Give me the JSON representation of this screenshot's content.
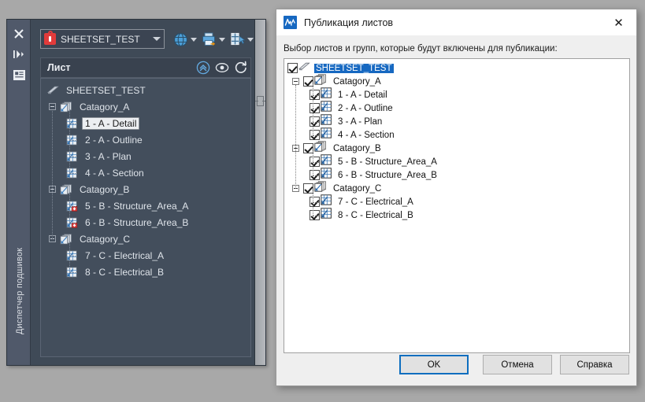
{
  "colors": {
    "desktop": "#a8a8a8",
    "palette_bg": "#3f4a57",
    "palette_gutter": "#50596a",
    "accent_blue": "#1668c1",
    "lock_red": "#e23b3b",
    "dialog_bg": "#efefef",
    "tree_bg": "#ffffff"
  },
  "palette": {
    "gutter": {
      "label": "Диспетчер подшивок",
      "icons": [
        {
          "name": "close-icon",
          "glyph": "✕"
        },
        {
          "name": "auto-hide-icon",
          "glyph": "⏯"
        },
        {
          "name": "properties-icon",
          "glyph": "▤"
        }
      ]
    },
    "combo": {
      "value": "SHEETSET_TEST",
      "icon": "lock-icon"
    },
    "toolbar": [
      {
        "name": "publish-button",
        "icon": "publish-globe-icon",
        "has_dropdown": true
      },
      {
        "name": "print-button",
        "icon": "printer-icon",
        "has_dropdown": true
      },
      {
        "name": "sheet-list-button",
        "icon": "sheet-list-icon",
        "has_dropdown": true
      }
    ],
    "list_header": {
      "title": "Лист",
      "buttons": [
        {
          "name": "collapse-all-button",
          "icon": "chevron-double-up-icon"
        },
        {
          "name": "preview-button",
          "icon": "eye-icon"
        },
        {
          "name": "refresh-button",
          "icon": "refresh-icon"
        }
      ]
    },
    "tree": {
      "root": {
        "label": "SHEETSET_TEST",
        "icon": "sheetset-icon"
      },
      "items": [
        {
          "label": "Catagory_A",
          "level": 1,
          "type": "category",
          "expanded": true
        },
        {
          "label": "1 - A - Detail",
          "level": 2,
          "type": "sheet",
          "selected": true
        },
        {
          "label": "2 - A - Outline",
          "level": 2,
          "type": "sheet"
        },
        {
          "label": "3 - A - Plan",
          "level": 2,
          "type": "sheet"
        },
        {
          "label": "4 - A - Section",
          "level": 2,
          "type": "sheet"
        },
        {
          "label": "Catagory_B",
          "level": 1,
          "type": "category",
          "expanded": true
        },
        {
          "label": "5 - B - Structure_Area_A",
          "level": 2,
          "type": "sheet",
          "locked": true
        },
        {
          "label": "6 - B - Structure_Area_B",
          "level": 2,
          "type": "sheet",
          "locked": true
        },
        {
          "label": "Catagory_C",
          "level": 1,
          "type": "category",
          "expanded": true
        },
        {
          "label": "7 - C - Electrical_A",
          "level": 2,
          "type": "sheet"
        },
        {
          "label": "8 - C - Electrical_B",
          "level": 2,
          "type": "sheet"
        }
      ]
    }
  },
  "dialog": {
    "title": "Публикация листов",
    "app_icon": "autocad-icon",
    "close_label": "✕",
    "instruction": "Выбор листов и групп, которые будут включены для публикации:",
    "tree": {
      "root": {
        "label": "SHEETSET_TEST",
        "checked": true,
        "selected": true,
        "icon": "sheetset-icon"
      },
      "items": [
        {
          "label": "Catagory_A",
          "level": 1,
          "type": "category",
          "checked": true,
          "expanded": true
        },
        {
          "label": "1 - A - Detail",
          "level": 2,
          "type": "sheet",
          "checked": true
        },
        {
          "label": "2 - A - Outline",
          "level": 2,
          "type": "sheet",
          "checked": true
        },
        {
          "label": "3 - A - Plan",
          "level": 2,
          "type": "sheet",
          "checked": true
        },
        {
          "label": "4 - A - Section",
          "level": 2,
          "type": "sheet",
          "checked": true
        },
        {
          "label": "Catagory_B",
          "level": 1,
          "type": "category",
          "checked": true,
          "expanded": true
        },
        {
          "label": "5 - B - Structure_Area_A",
          "level": 2,
          "type": "sheet",
          "checked": true
        },
        {
          "label": "6 - B - Structure_Area_B",
          "level": 2,
          "type": "sheet",
          "checked": true
        },
        {
          "label": "Catagory_C",
          "level": 1,
          "type": "category",
          "checked": true,
          "expanded": true
        },
        {
          "label": "7 - C - Electrical_A",
          "level": 2,
          "type": "sheet",
          "checked": true
        },
        {
          "label": "8 - C - Electrical_B",
          "level": 2,
          "type": "sheet",
          "checked": true
        }
      ]
    },
    "buttons": {
      "ok": "OK",
      "cancel": "Отмена",
      "help": "Справка"
    }
  }
}
